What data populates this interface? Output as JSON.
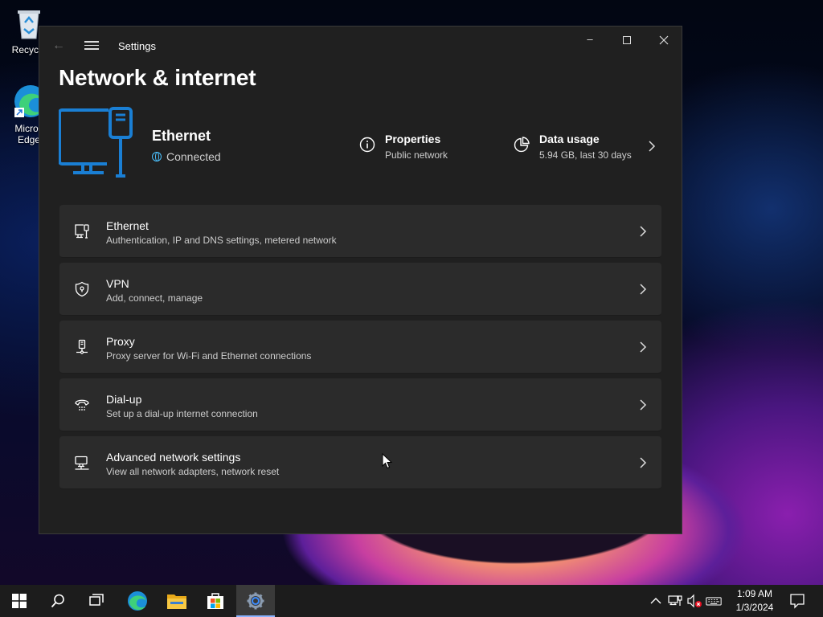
{
  "desktop": {
    "icons": [
      {
        "label": "Recycle"
      },
      {
        "label": "Micros\nEdge"
      }
    ]
  },
  "window": {
    "title": "Settings",
    "back_icon": "back-arrow-icon",
    "menu_icon": "hamburger-icon"
  },
  "page": {
    "title": "Network & internet"
  },
  "hero": {
    "name": "Ethernet",
    "status": "Connected",
    "properties": {
      "title": "Properties",
      "subtitle": "Public network"
    },
    "data_usage": {
      "title": "Data usage",
      "subtitle": "5.94 GB, last 30 days"
    }
  },
  "cards": [
    {
      "title": "Ethernet",
      "subtitle": "Authentication, IP and DNS settings, metered network",
      "icon": "ethernet-icon"
    },
    {
      "title": "VPN",
      "subtitle": "Add, connect, manage",
      "icon": "vpn-shield-icon"
    },
    {
      "title": "Proxy",
      "subtitle": "Proxy server for Wi-Fi and Ethernet connections",
      "icon": "proxy-icon"
    },
    {
      "title": "Dial-up",
      "subtitle": "Set up a dial-up internet connection",
      "icon": "dialup-icon"
    },
    {
      "title": "Advanced network settings",
      "subtitle": "View all network adapters, network reset",
      "icon": "advanced-network-icon"
    }
  ],
  "taskbar": {
    "time": "1:09 AM",
    "date": "1/3/2024"
  },
  "colors": {
    "accent": "#1a7fd4",
    "window_bg": "#202020",
    "card_bg": "#2b2b2b",
    "taskbar_bg": "#1c1c1c"
  }
}
